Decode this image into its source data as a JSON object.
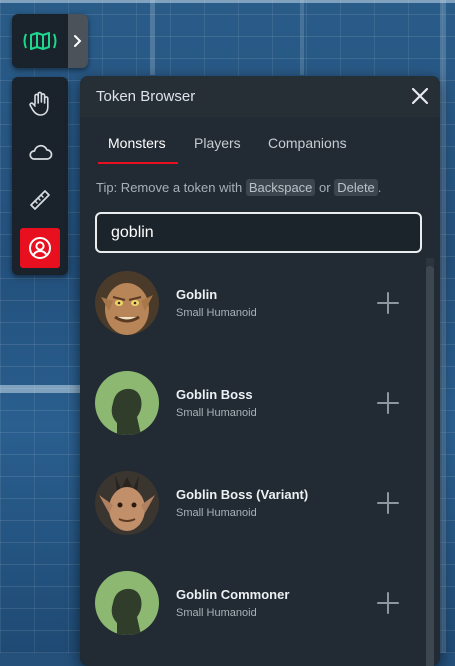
{
  "panel": {
    "title": "Token Browser",
    "tabs": [
      {
        "label": "Monsters",
        "active": true
      },
      {
        "label": "Players",
        "active": false
      },
      {
        "label": "Companions",
        "active": false
      }
    ],
    "tip": {
      "prefix": "Tip: Remove a token with ",
      "key1": "Backspace",
      "middle": " or ",
      "key2": "Delete",
      "suffix": "."
    },
    "search": {
      "value": "goblin",
      "placeholder": ""
    },
    "items": [
      {
        "name": "Goblin",
        "type": "Small Humanoid",
        "avatar": "goblin-portrait"
      },
      {
        "name": "Goblin Boss",
        "type": "Small Humanoid",
        "avatar": "silhouette"
      },
      {
        "name": "Goblin Boss (Variant)",
        "type": "Small Humanoid",
        "avatar": "goblin-boss-portrait"
      },
      {
        "name": "Goblin Commoner",
        "type": "Small Humanoid",
        "avatar": "silhouette"
      }
    ]
  },
  "toolbar": {
    "map_icon": "map-icon",
    "tools": [
      "hand-icon",
      "cloud-icon",
      "ruler-icon",
      "user-circle-icon"
    ],
    "active_tool": "user-circle-icon"
  },
  "colors": {
    "accent": "#e8101e",
    "map_icon": "#1ed68e",
    "panel_bg": "#222b33",
    "avatar_green": "#8db872"
  }
}
